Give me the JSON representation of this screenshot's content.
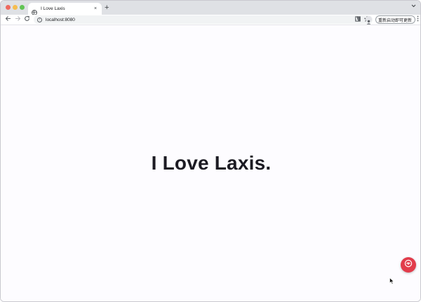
{
  "browser": {
    "tab": {
      "title": "I Love Laxis",
      "favicon_icon": "globe-icon",
      "close_label": "×"
    },
    "new_tab_label": "+",
    "tab_search_icon": "chevron-down-icon",
    "toolbar": {
      "url": "localhost:8080",
      "update_button_label": "重新启动即可更新",
      "icons": [
        "back-icon",
        "forward-icon",
        "reload-icon",
        "info-icon",
        "share-icon",
        "star-icon",
        "side-panel-icon",
        "profile-icon",
        "more-icon"
      ]
    }
  },
  "page": {
    "headline": "I Love Laxis.",
    "fab_icon": "chat-icon"
  },
  "colors": {
    "tabstrip": "#dfe1e5",
    "page_background": "#fdfcff",
    "headline": "#1c1b23",
    "fab": "#e23c4b"
  }
}
